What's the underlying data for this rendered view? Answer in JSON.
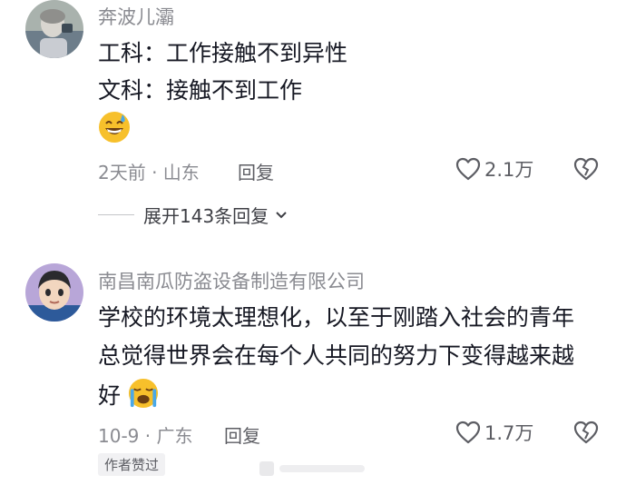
{
  "comments": [
    {
      "username": "奔波儿灞",
      "lines": [
        "工科：工作接触不到异性",
        "文科：接触不到工作"
      ],
      "emoji": "grinning-sweat-emoji",
      "time_location": "2天前 · 山东",
      "reply_label": "回复",
      "likes": "2.1万",
      "expand_label": "展开143条回复"
    },
    {
      "username": "南昌南瓜防盗设备制造有限公司",
      "lines": [
        "学校的环境太理想化，以至于刚踏入社会的青年",
        "总觉得世界会在每个人共同的努力下变得越来越",
        "好"
      ],
      "emoji": "loudly-crying-emoji",
      "time_location": "10-9 · 广东",
      "reply_label": "回复",
      "likes": "1.7万",
      "author_badge": "作者赞过"
    }
  ],
  "colors": {
    "primary_text": "#161823",
    "secondary_text": "#8a8b91",
    "emoji_yellow": "#f7c02b",
    "tear_blue": "#4aa8e8"
  }
}
